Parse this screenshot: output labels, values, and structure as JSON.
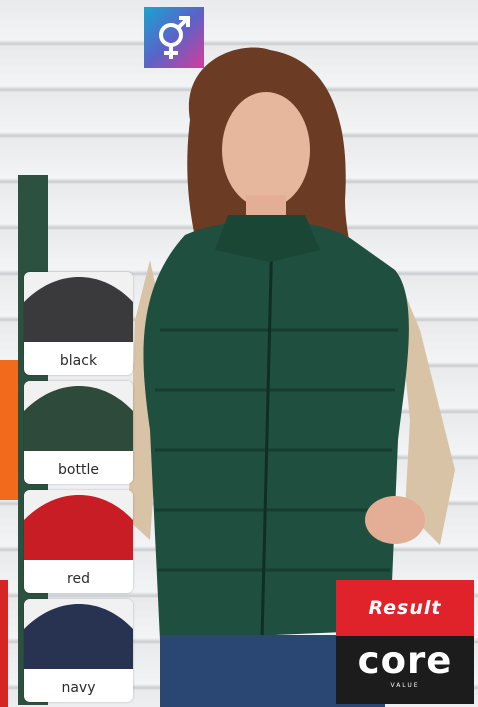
{
  "swatches": [
    {
      "label": "black",
      "color": "#3a3a3c"
    },
    {
      "label": "bottle",
      "color": "#2e4a3a"
    },
    {
      "label": "red",
      "color": "#c81d24"
    },
    {
      "label": "navy",
      "color": "#283352"
    }
  ],
  "logo": {
    "brand": "Result",
    "product": "core",
    "tagline": "VALUE"
  },
  "icons": {
    "gender": "unisex-icon"
  }
}
